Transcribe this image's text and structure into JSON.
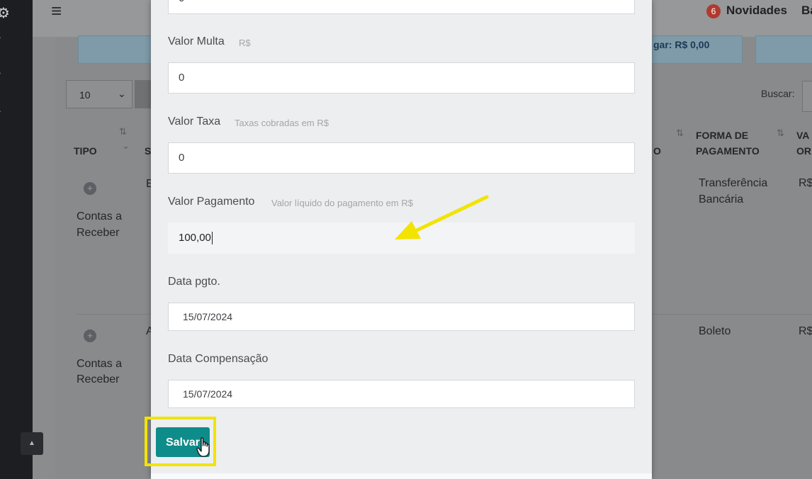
{
  "sidebar": {
    "icons": [
      "gear-icon",
      "chevron-icon",
      "chevron-icon",
      "chevron-icon",
      "scroll-up-icon"
    ]
  },
  "topbar": {
    "menu_icon": "hamburger-icon",
    "news_count": "6",
    "news_label": "Novidades",
    "user_initial": "Ba"
  },
  "summary": {
    "payable_text": "gar: R$ 0,00"
  },
  "table_controls": {
    "page_size": "10",
    "search_label": "Buscar:"
  },
  "table": {
    "headers": {
      "tipo": "TIPO",
      "s": "S",
      "o": "O",
      "forma_pagamento_1": "FORMA DE",
      "forma_pagamento_2": "PAGAMENTO",
      "valor_1": "VA",
      "valor_2": "OR"
    },
    "rows": [
      {
        "tipo_1": "Contas a",
        "tipo_2": "Receber",
        "s": "E",
        "forma_1": "Transferência",
        "forma_2": "Bancária",
        "valor": "R$"
      },
      {
        "tipo_1": "Contas a",
        "tipo_2": "Receber",
        "s": "A",
        "forma_1": "Boleto",
        "forma_2": "",
        "valor": "R$"
      }
    ]
  },
  "modal": {
    "top_partial_value": "0",
    "fields": {
      "multa": {
        "label": "Valor Multa",
        "hint": "R$",
        "value": "0"
      },
      "taxa": {
        "label": "Valor Taxa",
        "hint": "Taxas cobradas em R$",
        "value": "0"
      },
      "pagamento": {
        "label": "Valor Pagamento",
        "hint": "Valor líquido do pagamento em R$",
        "value": "100,00"
      },
      "data_pgto": {
        "label": "Data pgto.",
        "value": "15/07/2024"
      },
      "data_compensacao": {
        "label": "Data Compensação",
        "value": "15/07/2024"
      }
    },
    "save_label": "Salvar"
  },
  "annotations": {
    "highlight_color": "#f2e300",
    "arrow_color": "#f2e300"
  },
  "colors": {
    "accent": "#0e8c8a",
    "badge": "#b13a2e"
  }
}
